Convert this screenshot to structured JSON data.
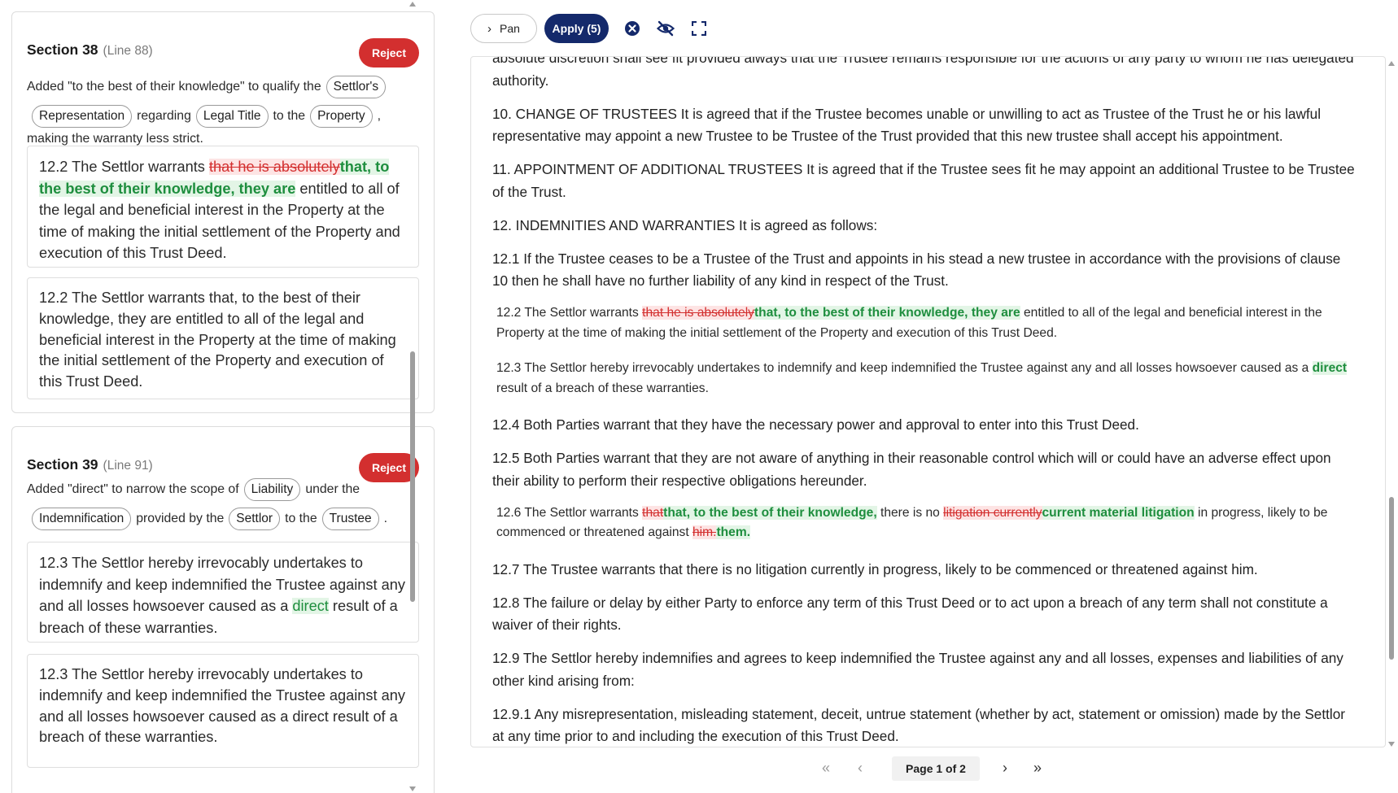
{
  "cards": [
    {
      "title": "Section 38",
      "line": "(Line 88)",
      "reject_label": "Reject",
      "summary": {
        "t1": "Added \"to the best of their knowledge\" to qualify the",
        "chip1": "Settlor's",
        "chip2": "Representation",
        "t2": "regarding",
        "chip3": "Legal Title",
        "t3": "to the",
        "chip4": "Property",
        "t4": ",",
        "t5": "making the warranty less strict."
      },
      "diff": {
        "pre": "12.2 The Settlor warrants ",
        "del": "that he is absolutely",
        "ins": "that, to the best of their knowledge, they are",
        "post": " entitled to all of the legal and beneficial interest in the Property at the time of making the initial settlement of the Property and execution of this Trust Deed."
      },
      "result": "12.2 The Settlor warrants that, to the best of their knowledge, they are entitled to all of the legal and beneficial interest in the Property at the time of making the initial settlement of the Property and execution of this Trust Deed."
    },
    {
      "title": "Section 39",
      "line": "(Line 91)",
      "reject_label": "Reject",
      "summary": {
        "t1": "Added \"direct\" to narrow the scope of",
        "chip1": "Liability",
        "t2": "under the",
        "chip2": "Indemnification",
        "t3": "provided by the",
        "chip3": "Settlor",
        "t4": "to the",
        "chip4": "Trustee",
        "t5": "."
      },
      "diff": {
        "pre": "12.3 The Settlor hereby irrevocably undertakes to indemnify and keep indemnified the Trustee against any and all losses howsoever caused as a ",
        "ins": "direct",
        "post": " result of a breach of these warranties."
      },
      "result": "12.3 The Settlor hereby irrevocably undertakes to indemnify and keep indemnified the Trustee against any and all losses howsoever caused as a direct result of a breach of these warranties."
    }
  ],
  "toolbar": {
    "pan_label": "Pan",
    "apply_label": "Apply (5)"
  },
  "document": {
    "p0": "absolute discretion shall see fit provided always that the Trustee remains responsible for the actions of any party to whom he has delegated authority.",
    "p10": "10. CHANGE OF TRUSTEES It is agreed that if the Trustee becomes unable or unwilling to act as Trustee of the Trust he or his lawful representative may appoint a new Trustee to be Trustee of the Trust provided that this new trustee shall accept his appointment.",
    "p11": "11. APPOINTMENT OF ADDITIONAL TRUSTEES It is agreed that if the Trustee sees fit he may appoint an additional Trustee to be Trustee of the Trust.",
    "p12": "12. INDEMNITIES AND WARRANTIES It is agreed as follows:",
    "p121": "12.1 If the Trustee ceases to be a Trustee of the Trust and appoints in his stead a new trustee in accordance with the provisions of clause 10 then he shall have no further liability of any kind in respect of the Trust.",
    "c122": {
      "pre": "12.2 The Settlor warrants ",
      "del": "that he is absolutely",
      "ins": "that, to the best of their knowledge, they are",
      "post": " entitled to all of the legal and beneficial interest in the Property at the time of making the initial settlement of the Property and execution of this Trust Deed."
    },
    "c123": {
      "pre": "12.3 The Settlor hereby irrevocably undertakes to indemnify and keep indemnified the Trustee against any and all losses howsoever caused as a ",
      "ins": "direct",
      "post": " result of a breach of these warranties."
    },
    "p124": "12.4 Both Parties warrant that they have the necessary power and approval to enter into this Trust Deed.",
    "p125": "12.5 Both Parties warrant that they are not aware of anything in their reasonable control which will or could have an adverse effect upon their ability to perform their respective obligations hereunder.",
    "c126": {
      "pre": "12.6 The Settlor warrants ",
      "del1": "that",
      "ins1": "that, to the best of their knowledge,",
      "mid": " there is no ",
      "del2": "litigation currently",
      "ins2": "current material litigation",
      "mid2": " in progress, likely to be commenced or threatened against ",
      "del3": "him.",
      "ins3": "them."
    },
    "p127": "12.7 The Trustee warrants that there is no litigation currently in progress, likely to be commenced or threatened against him.",
    "p128": "12.8 The failure or delay by either Party to enforce any term of this Trust Deed or to act upon a breach of any term shall not constitute a waiver of their rights.",
    "p129": "12.9 The Settlor hereby indemnifies and agrees to keep indemnified the Trustee against any and all losses, expenses and liabilities of any other kind arising from:",
    "p1291": "12.9.1 Any misrepresentation, misleading statement, deceit, untrue statement (whether by act, statement or omission) made by the Settlor at any time prior to and including the execution of this Trust Deed."
  },
  "pager": {
    "label": "Page 1 of 2"
  },
  "colors": {
    "reject": "#d32f2f",
    "apply": "#14296b",
    "inserted": "#1e8e3e",
    "deleted": "#d32f2f"
  }
}
